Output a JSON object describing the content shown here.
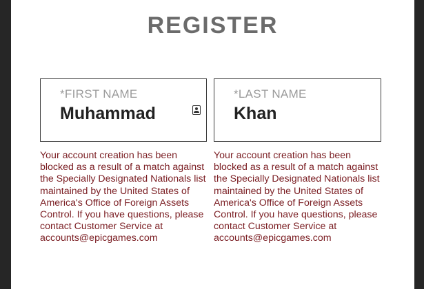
{
  "title": "REGISTER",
  "fields": {
    "first_name": {
      "label": "*FIRST NAME",
      "value": "Muhammad",
      "error": "Your account creation has been blocked as a result of a match against the Specially Designated Nationals list maintained by the United States of America's Office of Foreign Assets Control. If you have questions, please contact Customer Service at accounts@epicgames.com"
    },
    "last_name": {
      "label": "*LAST NAME",
      "value": "Khan",
      "error": "Your account creation has been blocked as a result of a match against the Specially Designated Nationals list maintained by the United States of America's Office of Foreign Assets Control. If you have questions, please contact Customer Service at accounts@epicgames.com"
    }
  },
  "icons": {
    "first_name_field": "contact-card-icon"
  },
  "colors": {
    "frame": "#262626",
    "title": "#6b6b6b",
    "label": "#9a9a9a",
    "input_text": "#222222",
    "error_text": "#7a1d22",
    "field_border": "#3a3a3a"
  }
}
